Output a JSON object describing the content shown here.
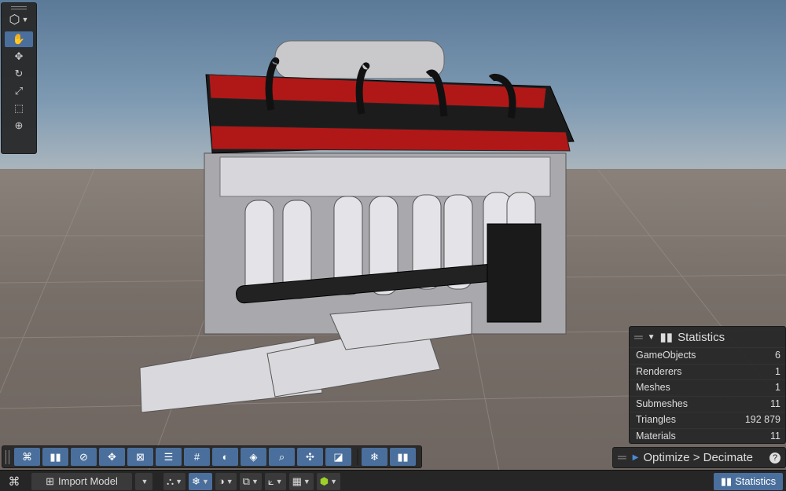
{
  "stats": {
    "title": "Statistics",
    "rows": [
      {
        "label": "GameObjects",
        "value": "6"
      },
      {
        "label": "Renderers",
        "value": "1"
      },
      {
        "label": "Meshes",
        "value": "1"
      },
      {
        "label": "Submeshes",
        "value": "11"
      },
      {
        "label": "Triangles",
        "value": "192 879"
      },
      {
        "label": "Materials",
        "value": "11"
      }
    ]
  },
  "optimize": {
    "label": "Optimize > Decimate",
    "help": "?"
  },
  "bottombar": {
    "import_label": "Import Model",
    "statistics_label": "Statistics"
  },
  "colors": {
    "accent": "#4a6f9c",
    "panel": "#282828",
    "engine_red": "#b01818"
  },
  "toolbar": {
    "icons": [
      "plugin-icon",
      "chart-icon",
      "compass-icon",
      "move-icon",
      "wireframe-icon",
      "align-icon",
      "grid-icon",
      "shading-icon",
      "layers-icon",
      "search-icon",
      "pivot-icon",
      "paint-icon",
      "light-icon",
      "stats-icon"
    ]
  },
  "vertical_tools": [
    "view-cube-icon",
    "hand-icon",
    "move-icon",
    "rotate-icon",
    "scale-icon",
    "rect-icon",
    "transform-icon"
  ]
}
